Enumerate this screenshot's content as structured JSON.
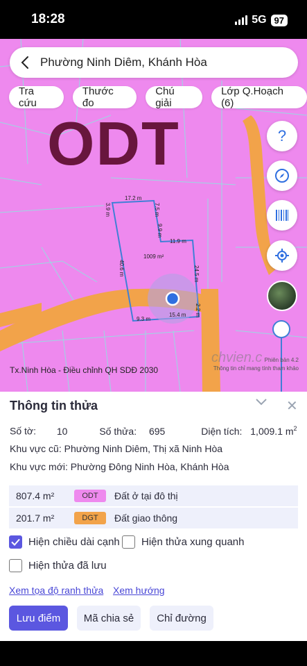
{
  "status": {
    "time": "18:28",
    "network": "5G",
    "battery": "97"
  },
  "search": {
    "title": "Phường Ninh Diêm, Khánh Hòa"
  },
  "chips": [
    "Tra cứu",
    "Thước đo",
    "Chú giải",
    "Lớp Q.Hoạch (6)"
  ],
  "map": {
    "zone_label": "ODT",
    "edges": [
      "17.2 m",
      "7.5 m",
      "3.9 m",
      "9.9 m",
      "11.9 m",
      "1009 m²",
      "40.6 m",
      "24.5 m",
      "2.2 m",
      "9.3 m",
      "15.4 m"
    ],
    "footer": "Tx.Ninh Hòa - Điều chỉnh QH SDĐ 2030",
    "version": "Phiên bản 4.2",
    "note": "Thông tin chỉ mang tính tham khảo",
    "watermark": "chvien.c"
  },
  "sheet": {
    "title": "Thông tin thửa",
    "so_to_label": "Số tờ:",
    "so_to": "10",
    "so_thua_label": "Số thửa:",
    "so_thua": "695",
    "dien_tich_label": "Diện tích:",
    "dien_tich": "1,009.1 m",
    "dien_tich_sup": "2",
    "old_area": "Khu vực cũ: Phường Ninh Diêm, Thị xã Ninh Hòa",
    "new_area": "Khu vực mới: Phường Đông Ninh Hòa, Khánh Hòa",
    "land_types": [
      {
        "area": "807.4 m²",
        "code": "ODT",
        "name": "Đất ở tại đô thị",
        "color": "#ee89ee"
      },
      {
        "area": "201.7 m²",
        "code": "DGT",
        "name": "Đất giao thông",
        "color": "#f2a34a"
      }
    ],
    "opt_edge": "Hiện chiều dài cạnh",
    "opt_neighbor": "Hiện thửa xung quanh",
    "opt_saved": "Hiện thửa đã lưu",
    "link_coords": "Xem tọa độ ranh thửa",
    "link_direction": "Xem hướng",
    "btn_save": "Lưu điểm",
    "btn_share": "Mã chia sẻ",
    "btn_route": "Chỉ đường"
  }
}
